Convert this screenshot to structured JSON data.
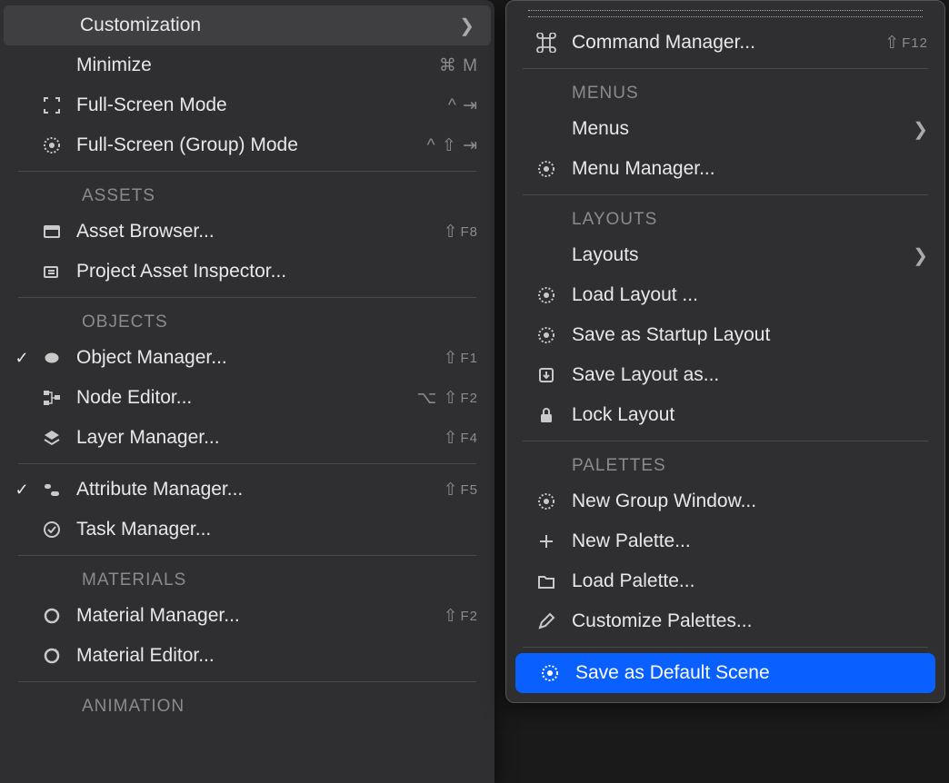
{
  "left": {
    "items": [
      {
        "label": "Customization",
        "submenu": true,
        "highlight": "grey"
      },
      {
        "label": "Minimize",
        "shortcut": "⌘ M"
      },
      {
        "label": "Full-Screen Mode",
        "icon": "fullscreen",
        "shortcut": "^ ⇥"
      },
      {
        "label": "Full-Screen (Group) Mode",
        "icon": "gear",
        "shortcut": "^ ⇧ ⇥"
      }
    ],
    "assets_header": "ASSETS",
    "assets": [
      {
        "label": "Asset Browser...",
        "icon": "asset-browser",
        "shortcut": "⇧ F8"
      },
      {
        "label": "Project Asset Inspector...",
        "icon": "folder-list"
      }
    ],
    "objects_header": "OBJECTS",
    "objects": [
      {
        "label": "Object Manager...",
        "icon": "sphere",
        "checked": true,
        "shortcut": "⇧ F1"
      },
      {
        "label": "Node Editor...",
        "icon": "nodes",
        "shortcut": "⌥ ⇧ F2"
      },
      {
        "label": "Layer Manager...",
        "icon": "layers",
        "shortcut": "⇧ F4"
      }
    ],
    "attr": [
      {
        "label": "Attribute Manager...",
        "icon": "sliders",
        "checked": true,
        "shortcut": "⇧ F5"
      },
      {
        "label": "Task Manager...",
        "icon": "check-circle"
      }
    ],
    "materials_header": "MATERIALS",
    "materials": [
      {
        "label": "Material Manager...",
        "icon": "ring",
        "shortcut": "⇧ F2"
      },
      {
        "label": "Material Editor...",
        "icon": "ring-arrow"
      }
    ],
    "animation_header": "ANIMATION"
  },
  "right": {
    "cmd": {
      "label": "Command Manager...",
      "icon": "command",
      "shortcut": "⇧ F12"
    },
    "menus_header": "MENUS",
    "menus": [
      {
        "label": "Menus",
        "submenu": true
      },
      {
        "label": "Menu Manager...",
        "icon": "gear"
      }
    ],
    "layouts_header": "LAYOUTS",
    "layouts": [
      {
        "label": "Layouts",
        "submenu": true
      },
      {
        "label": "Load Layout ...",
        "icon": "gear"
      },
      {
        "label": "Save as Startup Layout",
        "icon": "gear"
      },
      {
        "label": "Save Layout as...",
        "icon": "download"
      },
      {
        "label": "Lock Layout",
        "icon": "lock"
      }
    ],
    "palettes_header": "PALETTES",
    "palettes": [
      {
        "label": "New Group Window...",
        "icon": "gear"
      },
      {
        "label": "New Palette...",
        "icon": "plus"
      },
      {
        "label": "Load Palette...",
        "icon": "folder"
      },
      {
        "label": "Customize Palettes...",
        "icon": "pencil"
      }
    ],
    "save_scene": {
      "label": "Save as Default Scene",
      "icon": "gear",
      "highlight": "blue"
    }
  }
}
